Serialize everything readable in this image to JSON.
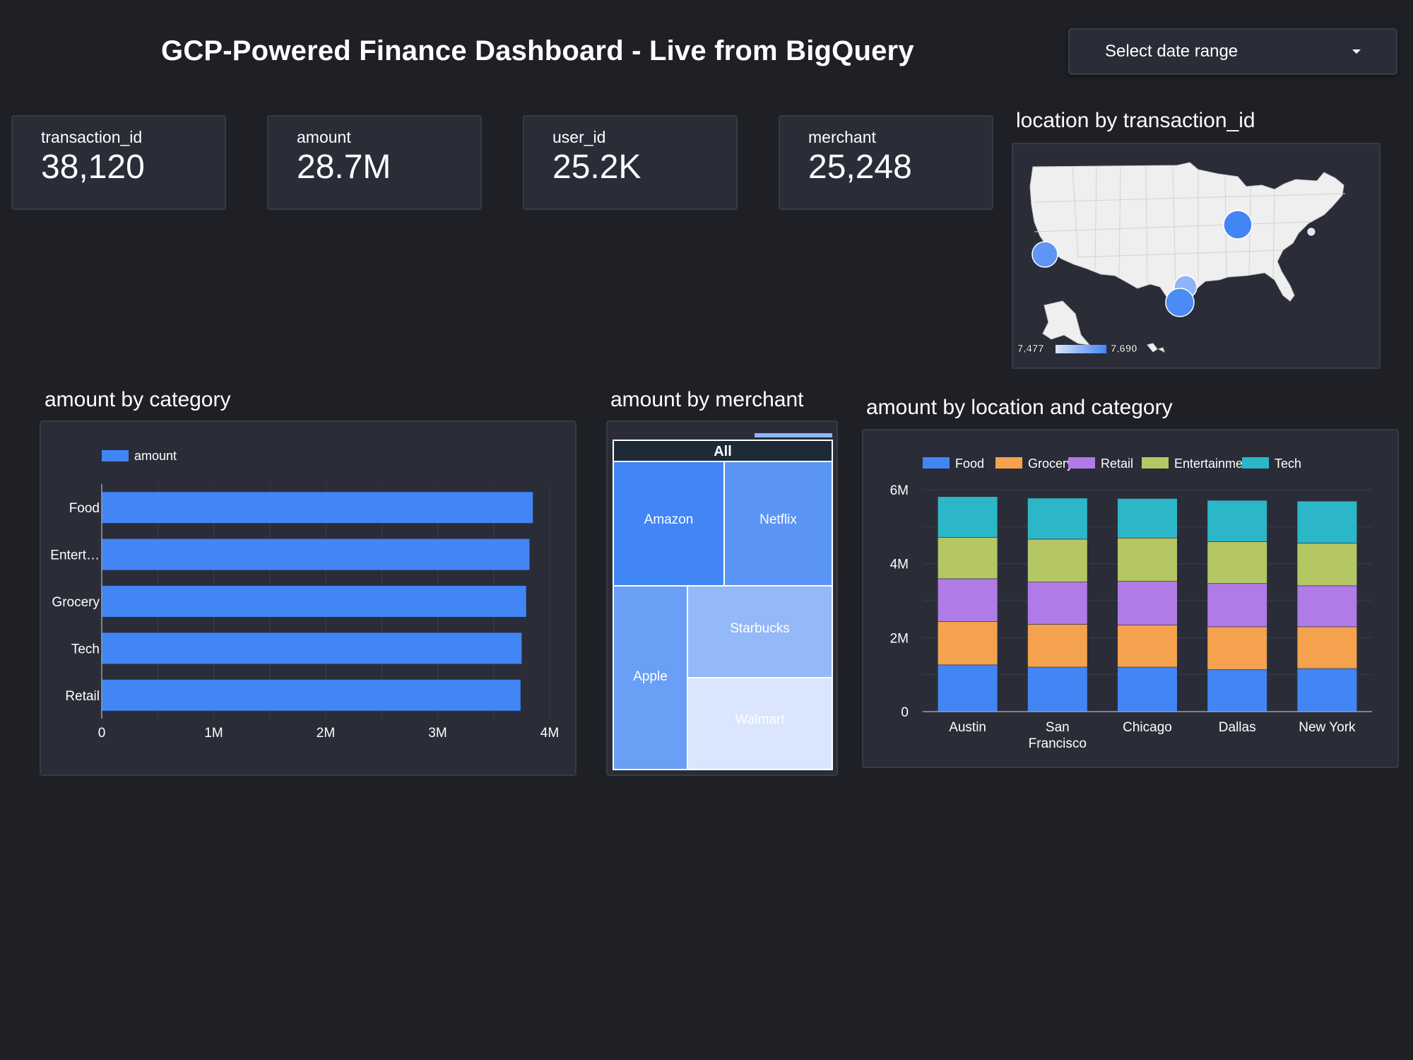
{
  "header": {
    "title": "GCP-Powered Finance Dashboard - Live from BigQuery",
    "date_select_label": "Select date range"
  },
  "kpis": [
    {
      "label": "transaction_id",
      "value": "38,120"
    },
    {
      "label": "amount",
      "value": "28.7M"
    },
    {
      "label": "user_id",
      "value": "25.2K"
    },
    {
      "label": "merchant",
      "value": "25,248"
    }
  ],
  "map": {
    "title": "location by transaction_id",
    "legend_min": "7,477",
    "legend_max": "7,690",
    "bubbles": [
      {
        "city": "San Francisco",
        "value": 7590
      },
      {
        "city": "Chicago",
        "value": 7690
      },
      {
        "city": "Dallas",
        "value": 7520
      },
      {
        "city": "Austin",
        "value": 7660
      },
      {
        "city": "New York",
        "value": 7477
      }
    ]
  },
  "colors": {
    "blue": "#4285f4",
    "orange": "#f4a24e",
    "purple": "#b07be7",
    "olive": "#b5c765",
    "teal": "#2cb7c9",
    "panel": "#2a2d38",
    "background": "#1f2025"
  },
  "chart_data": [
    {
      "type": "bar",
      "orientation": "horizontal",
      "title": "amount by category",
      "legend": [
        "amount"
      ],
      "categories": [
        "Food",
        "Entert…",
        "Grocery",
        "Tech",
        "Retail"
      ],
      "series": [
        {
          "name": "amount",
          "values": [
            3850000,
            3820000,
            3790000,
            3750000,
            3740000
          ]
        }
      ],
      "xlim": [
        0,
        4000000
      ],
      "x_ticks": [
        "0",
        "1M",
        "2M",
        "3M",
        "4M"
      ],
      "grid": true
    },
    {
      "type": "treemap",
      "title": "amount by merchant",
      "root": "All",
      "items": [
        {
          "name": "Amazon",
          "color": "#4285f4"
        },
        {
          "name": "Netflix",
          "color": "#5a95f5"
        },
        {
          "name": "Apple",
          "color": "#6a9ff6"
        },
        {
          "name": "Starbucks",
          "color": "#94b9f9"
        },
        {
          "name": "Walmart",
          "color": "#d9e6fd"
        }
      ]
    },
    {
      "type": "bar",
      "stacked": true,
      "title": "amount by location and category",
      "categories": [
        "Austin",
        "San Francisco",
        "Chicago",
        "Dallas",
        "New York"
      ],
      "category_labels": [
        [
          "Austin"
        ],
        [
          "San",
          "Francisco"
        ],
        [
          "Chicago"
        ],
        [
          "Dallas"
        ],
        [
          "New York"
        ]
      ],
      "series": [
        {
          "name": "Food",
          "values": [
            1270000,
            1210000,
            1210000,
            1140000,
            1170000
          ]
        },
        {
          "name": "Grocery",
          "values": [
            1170000,
            1160000,
            1140000,
            1160000,
            1130000
          ]
        },
        {
          "name": "Retail",
          "values": [
            1160000,
            1140000,
            1180000,
            1170000,
            1110000
          ]
        },
        {
          "name": "Entertainment",
          "values": [
            1120000,
            1160000,
            1170000,
            1130000,
            1150000
          ]
        },
        {
          "name": "Tech",
          "values": [
            1100000,
            1110000,
            1070000,
            1120000,
            1140000
          ]
        }
      ],
      "ylim": [
        0,
        6000000
      ],
      "y_ticks": [
        "0",
        "2M",
        "4M",
        "6M"
      ],
      "legend_position": "top",
      "grid": true
    }
  ]
}
